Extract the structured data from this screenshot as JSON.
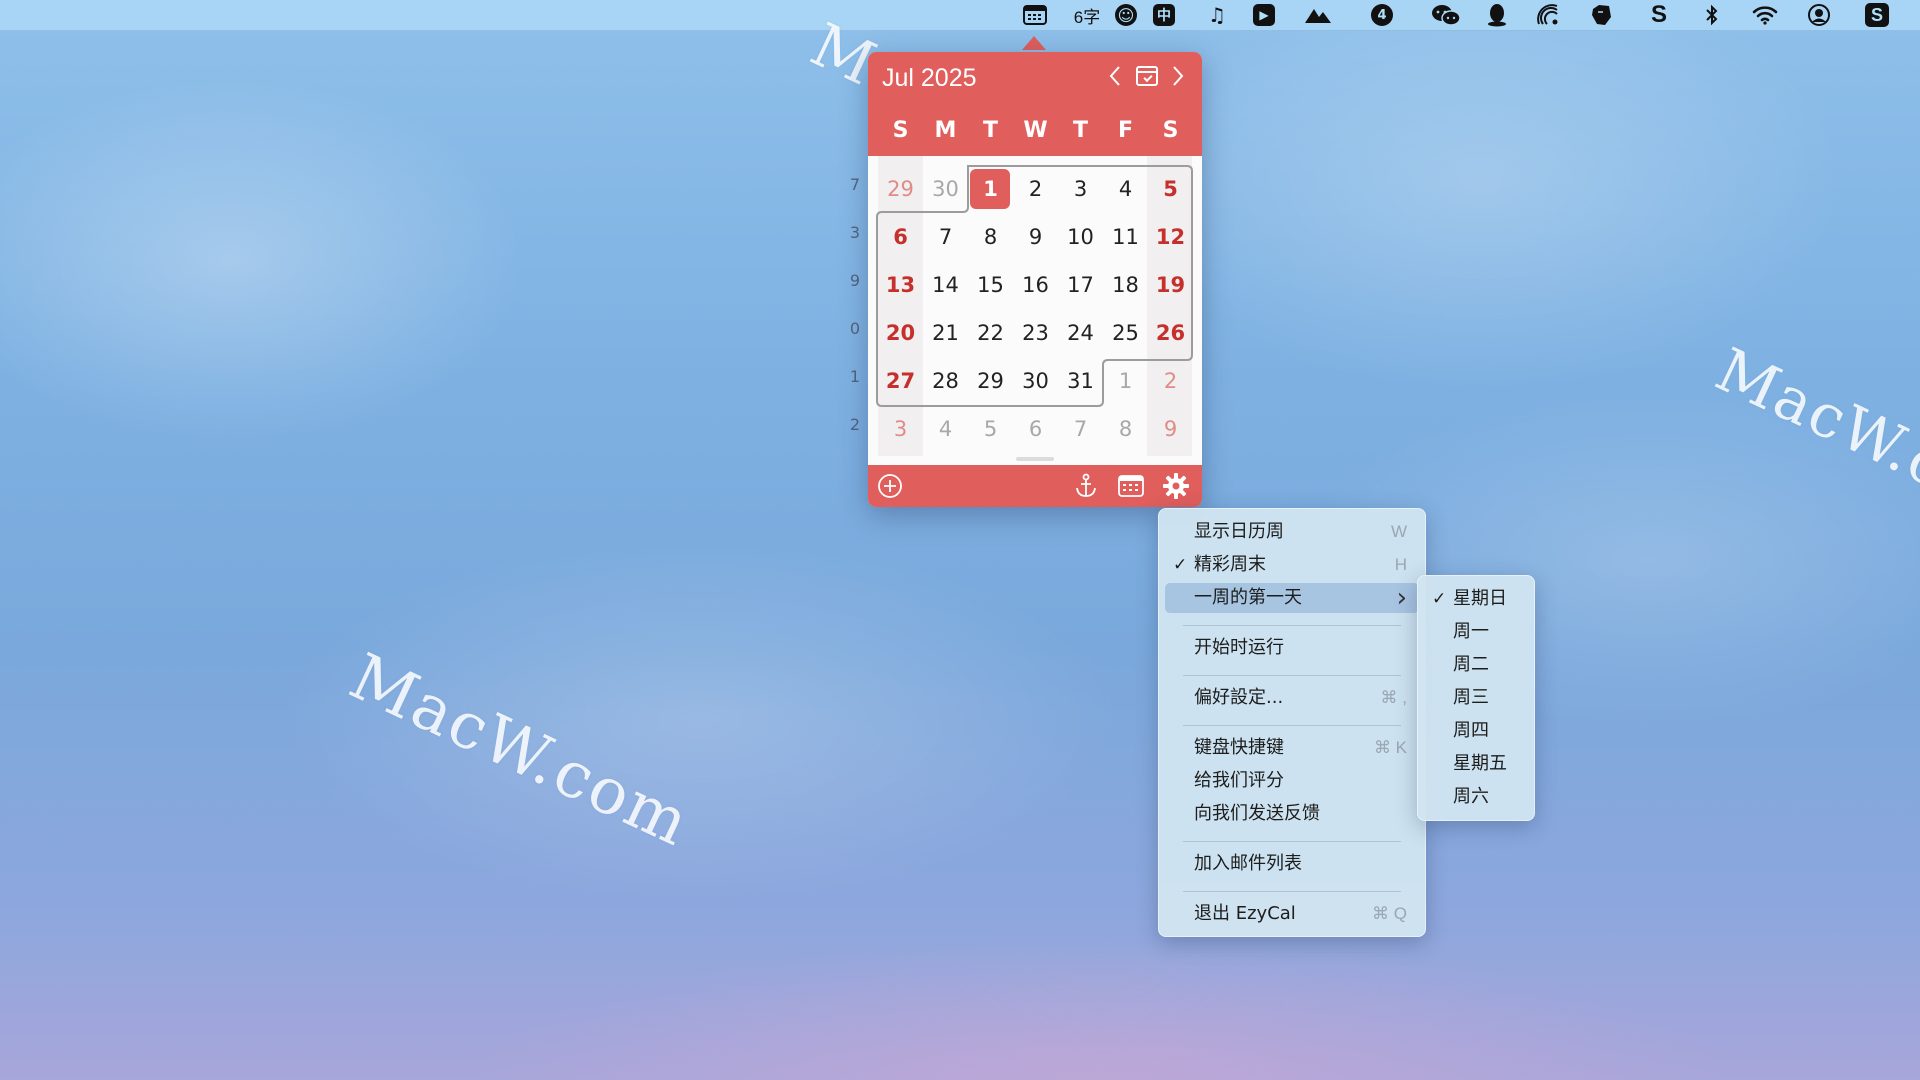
{
  "menubar": {
    "items": [
      {
        "name": "calendar-icon",
        "glyph": "▦"
      },
      {
        "name": "word-count",
        "text": "6字"
      },
      {
        "name": "smiley-icon",
        "glyph": "☻"
      },
      {
        "name": "input-method-icon",
        "text": "中"
      },
      {
        "name": "music-icon",
        "glyph": "♫"
      },
      {
        "name": "video-player-icon",
        "glyph": "▶"
      },
      {
        "name": "mountain-icon",
        "glyph": "▲"
      },
      {
        "name": "app-4-icon",
        "text": "4"
      },
      {
        "name": "wechat-icon",
        "glyph": "☁"
      },
      {
        "name": "qq-icon",
        "glyph": "♟"
      },
      {
        "name": "airdrop-icon",
        "glyph": "◌"
      },
      {
        "name": "evernote-icon",
        "glyph": "✎"
      },
      {
        "name": "s-app-icon",
        "text": "S"
      },
      {
        "name": "bluetooth-icon",
        "glyph": "✱"
      },
      {
        "name": "wifi-icon",
        "glyph": "◠"
      },
      {
        "name": "user-icon",
        "glyph": "◉"
      },
      {
        "name": "s-box-icon",
        "text": "S"
      }
    ]
  },
  "watermarks": [
    "MacW.com",
    "MacW.com",
    "MacW.com"
  ],
  "calendar": {
    "title": "Jul 2025",
    "prev": "<",
    "next": ">",
    "weekdays": [
      "S",
      "M",
      "T",
      "W",
      "T",
      "F",
      "S"
    ],
    "week_numbers": [
      "7",
      "3",
      "9",
      "0",
      "1",
      "2"
    ],
    "weeks": [
      [
        "29",
        "30",
        "1",
        "2",
        "3",
        "4",
        "5"
      ],
      [
        "6",
        "7",
        "8",
        "9",
        "10",
        "11",
        "12"
      ],
      [
        "13",
        "14",
        "15",
        "16",
        "17",
        "18",
        "19"
      ],
      [
        "20",
        "21",
        "22",
        "23",
        "24",
        "25",
        "26"
      ],
      [
        "27",
        "28",
        "29",
        "30",
        "31",
        "1",
        "2"
      ],
      [
        "3",
        "4",
        "5",
        "6",
        "7",
        "8",
        "9"
      ]
    ],
    "today": "1",
    "accent_color": "#e05e5c",
    "weekend_color": "#c6302c"
  },
  "menu": {
    "items": [
      {
        "label": "显示日历周",
        "shortcut": "W",
        "checked": false
      },
      {
        "label": "精彩周末",
        "shortcut": "H",
        "checked": true
      },
      {
        "label": "一周的第一天",
        "submenu": true,
        "highlighted": true
      },
      {
        "separator": true
      },
      {
        "label": "开始时运行"
      },
      {
        "separator": true
      },
      {
        "label": "偏好設定...",
        "shortcut": "⌘ ,"
      },
      {
        "separator": true
      },
      {
        "label": "键盘快捷键",
        "shortcut": "⌘ K"
      },
      {
        "label": "给我们评分"
      },
      {
        "label": "向我们发送反馈"
      },
      {
        "separator": true
      },
      {
        "label": "加入邮件列表"
      },
      {
        "separator": true
      },
      {
        "label": "退出 EzyCal",
        "shortcut": "⌘ Q"
      }
    ]
  },
  "submenu": {
    "items": [
      {
        "label": "星期日",
        "checked": true
      },
      {
        "label": "周一",
        "checked": false
      },
      {
        "label": "周二",
        "checked": false
      },
      {
        "label": "周三",
        "checked": false
      },
      {
        "label": "周四",
        "checked": false
      },
      {
        "label": "星期五",
        "checked": false
      },
      {
        "label": "周六",
        "checked": false
      }
    ]
  }
}
